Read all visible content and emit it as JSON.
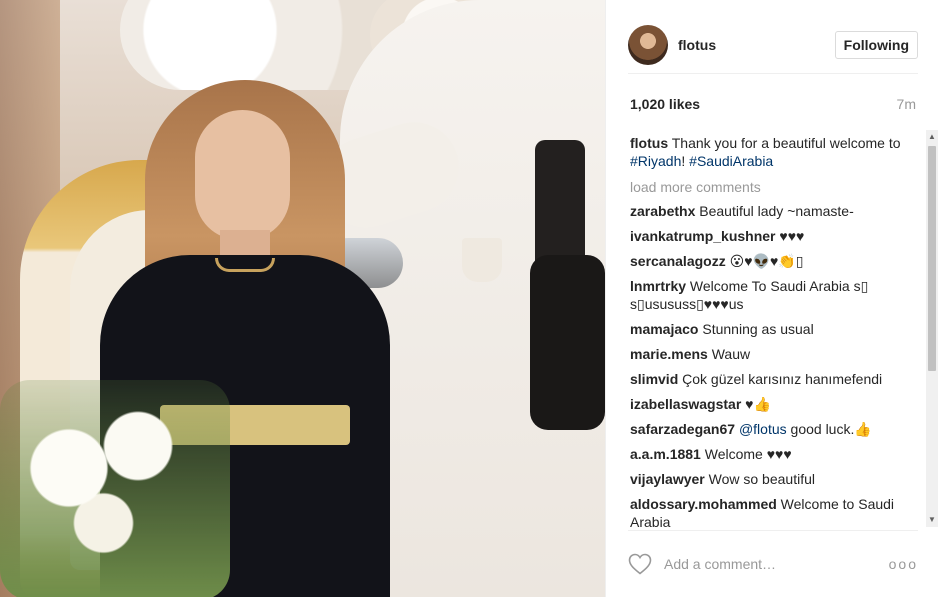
{
  "post": {
    "username": "flotus",
    "follow_label": "Following",
    "likes": "1,020 likes",
    "time": "7m"
  },
  "caption": {
    "user": "flotus",
    "text": " Thank you for a beautiful welcome to ",
    "tag1": "#Riyadh",
    "mid": "! ",
    "tag2": "#SaudiArabia"
  },
  "load_more": "load more comments",
  "comments": [
    {
      "user": "zarabethx",
      "text": " Beautiful lady ~namaste-"
    },
    {
      "user": "ivankatrump_kushner",
      "text": " ♥♥♥"
    },
    {
      "user": "sercanalagozz",
      "text": " 😮♥👽♥👏▯"
    },
    {
      "user": "lnmrtrky",
      "text": " Welcome To Saudi Arabia s▯ s▯usususs▯♥♥♥us"
    },
    {
      "user": "mamajaco",
      "text": " Stunning as usual"
    },
    {
      "user": "marie.mens",
      "text": " Wauw"
    },
    {
      "user": "slimvid",
      "text": " Çok güzel karısınız hanımefendi"
    },
    {
      "user": "izabellaswagstar",
      "text": " ♥👍"
    },
    {
      "user": "safarzadegan67",
      "text": " ",
      "tag": "@flotus",
      "after": " good luck.👍"
    },
    {
      "user": "a.a.m.1881",
      "text": " Welcome ♥♥♥"
    },
    {
      "user": "vijaylawyer",
      "text": " Wow so beautiful"
    },
    {
      "user": "aldossary.mohammed",
      "text": " Welcome to Saudi Arabia"
    }
  ],
  "footer": {
    "placeholder": "Add a comment…",
    "more": "ooo"
  },
  "icons": {
    "heart": "heart-icon",
    "more": "more-icon",
    "scroll_up": "▲",
    "scroll_down": "▼"
  }
}
